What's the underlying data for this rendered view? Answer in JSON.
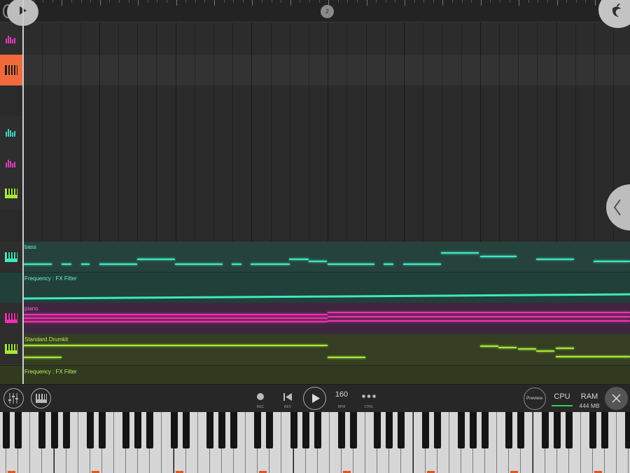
{
  "timeline": {
    "bar_marker": "2"
  },
  "colors": {
    "accent": "#f06a3b",
    "bass": "#3fe8c0",
    "piano": "#f02fb0",
    "drums": "#a6e83a",
    "cpu_meter": "#34d058"
  },
  "tracks": [
    {
      "icon": "drum-icon",
      "color": "#e03cbf",
      "kind": "drums"
    },
    {
      "icon": "piano-icon",
      "color": "#1c1c1c",
      "kind": "piano",
      "selected": true
    },
    {
      "icon": "none"
    },
    {
      "icon": "drum-icon",
      "color": "#3fd3c0",
      "kind": "drums"
    },
    {
      "icon": "drum-icon",
      "color": "#e03cbf",
      "kind": "drums"
    },
    {
      "icon": "piano-icon",
      "color": "#a6e83a",
      "kind": "piano"
    },
    {
      "icon": "none"
    }
  ],
  "clips": {
    "bass": {
      "label": "bass",
      "automation_label": "Frequency : FX Filter"
    },
    "piano": {
      "label": "piano"
    },
    "drums": {
      "label": "Standard Drumkit",
      "automation_label": "Frequency : FX Filter"
    }
  },
  "toolbar": {
    "rec_label": "REC",
    "rev_label": "REV",
    "bpm_value": "160",
    "bpm_label": "BPM",
    "ctrl_label": "CTRL",
    "preview_label": "Preview",
    "cpu_label": "CPU",
    "ram_label": "RAM",
    "ram_value": "444 MB"
  }
}
